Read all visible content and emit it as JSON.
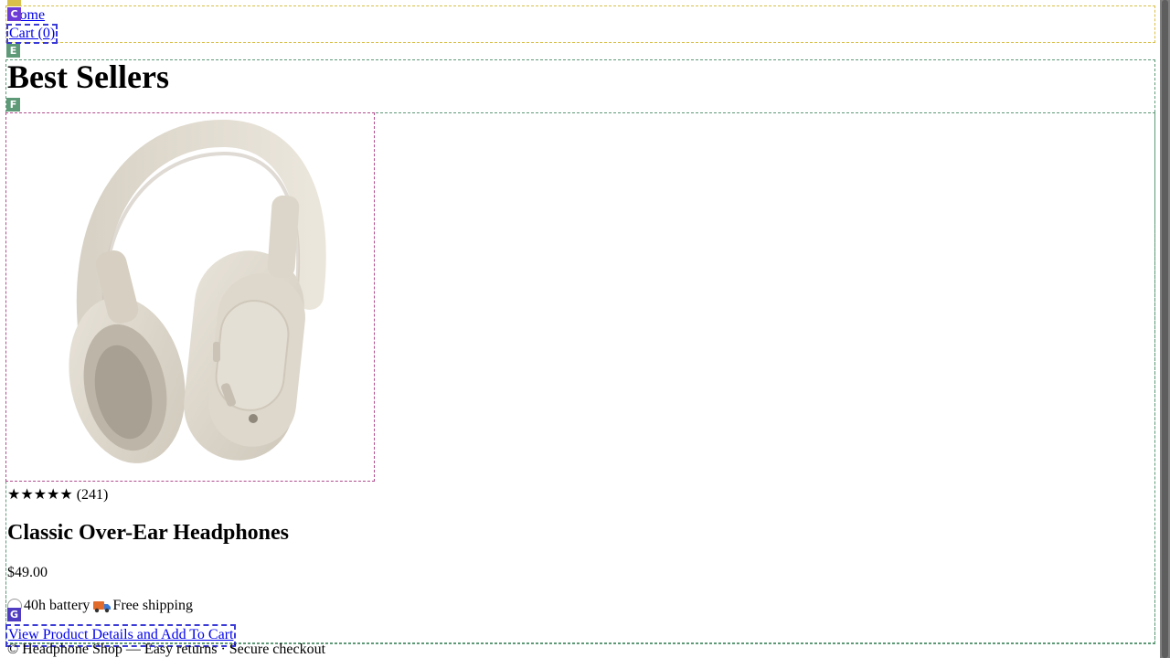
{
  "nav": {
    "home_label": "Home",
    "cart_label": "Cart (0)"
  },
  "main": {
    "heading": "Best Sellers"
  },
  "product": {
    "rating_stars": "★★★★★",
    "review_count": "(241)",
    "rating_value": 5,
    "name": "Classic Over-Ear Headphones",
    "price": "$49.00",
    "feature_battery": "40h battery",
    "feature_shipping": "Free shipping",
    "cta_label": "View Product Details and Add To Cart",
    "image_alt": "Beige over-ear headphones",
    "image_color": "#e3ddd2"
  },
  "overlay_tags": {
    "nav_tag": "C",
    "main_tag": "E",
    "grid_tag": "F",
    "cta_tag": "G"
  },
  "footer": {
    "text": "© Headphone Shop — Easy returns · Secure checkout"
  }
}
